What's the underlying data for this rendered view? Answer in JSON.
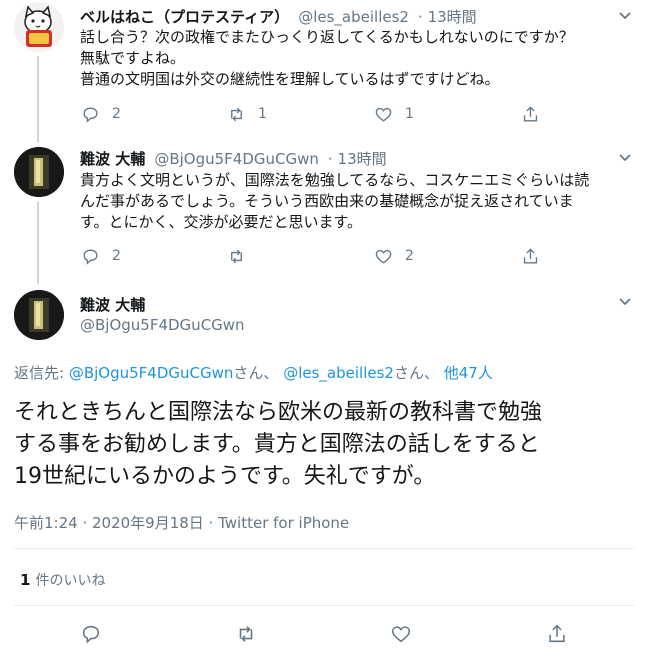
{
  "tweets": [
    {
      "name": "ベルはねこ（プロテスティア）",
      "handle": "@les_abeilles2",
      "time": "· 13時間",
      "text": "話し合う？次の政権でまたひっくり返してくるかもしれないのにですか？\n無駄ですよね。\n普通の文明国は外交の継続性を理解しているはずですけどね。",
      "replies": "2",
      "retweets": "1",
      "likes": "1"
    },
    {
      "name": "難波 大輔",
      "handle": "@BjOgu5F4DGuCGwn",
      "time": "· 13時間",
      "text": "貴方よく文明というが、国際法を勉強してるなら、コスケニエミぐらいは読\nんだ事があるでしょう。そういう西欧由来の基礎概念が捉え返されていま\nす。とにかく、交渉が必要だと思います。",
      "replies": "2",
      "retweets": "",
      "likes": "2"
    }
  ],
  "main_tweet": {
    "name": "難波 大輔",
    "handle": "@BjOgu5F4DGuCGwn",
    "reply_to_label": "返信先:",
    "reply_to_user1": "@BjOgu5F4DGuCGwn",
    "reply_to_sep1": "さん、",
    "reply_to_user2": "@les_abeilles2",
    "reply_to_sep2": "さん、",
    "reply_to_others": "他47人",
    "text": "それときちんと国際法なら欧米の最新の教科書で勉強\nする事をお勧めします。貴方と国際法の話しをすると\n19世紀にいるかのようです。失礼ですが。",
    "timestamp": "午前1:24 · 2020年9月18日 · Twitter for iPhone",
    "likes_count": "1",
    "likes_label": "件のいいね"
  },
  "avatar_badge_text": "ねこ",
  "colors": {
    "accent": "#1b95e0",
    "secondary_text": "#657786",
    "divider": "#e6ecf0"
  },
  "icons": [
    "reply-icon",
    "retweet-icon",
    "like-icon",
    "share-icon",
    "chevron-down-icon"
  ]
}
